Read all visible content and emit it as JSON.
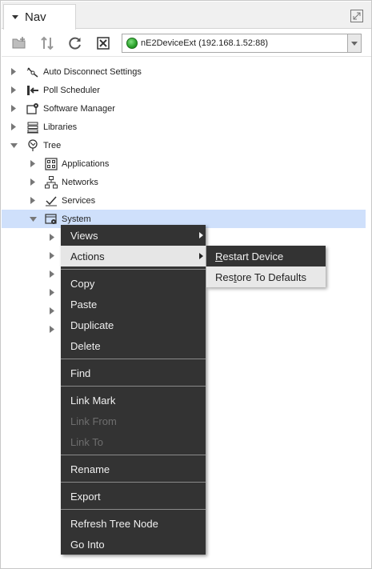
{
  "nav": {
    "tab_title": "Nav",
    "station": "nE2DeviceExt (192.168.1.52:88)"
  },
  "tree": {
    "items": [
      {
        "label": "Auto Disconnect Settings",
        "icon": "auto-disconnect-icon"
      },
      {
        "label": "Poll Scheduler",
        "icon": "poll-scheduler-icon"
      },
      {
        "label": "Software Manager",
        "icon": "software-manager-icon"
      },
      {
        "label": "Libraries",
        "icon": "libraries-icon"
      },
      {
        "label": "Tree",
        "icon": "tree-icon"
      },
      {
        "label": "Applications",
        "icon": "applications-icon"
      },
      {
        "label": "Networks",
        "icon": "networks-icon"
      },
      {
        "label": "Services",
        "icon": "services-icon"
      },
      {
        "label": "System",
        "icon": "system-icon"
      }
    ]
  },
  "context_menu": {
    "views": "Views",
    "actions": "Actions",
    "copy": "Copy",
    "paste": "Paste",
    "duplicate": "Duplicate",
    "delete": "Delete",
    "find": "Find",
    "link_mark": "Link Mark",
    "link_from": "Link From",
    "link_to": "Link To",
    "rename": "Rename",
    "export": "Export",
    "refresh_tree_node": "Refresh Tree Node",
    "go_into": "Go Into"
  },
  "actions_submenu": {
    "restart_device_key": "R",
    "restart_device_rest": "estart Device",
    "restore_defaults_pre": "Res",
    "restore_defaults_key": "t",
    "restore_defaults_rest": "ore To Defaults"
  },
  "colors": {
    "menu_bg": "#333333",
    "selection": "#cfe0fb",
    "status_online": "#2aa12a"
  }
}
